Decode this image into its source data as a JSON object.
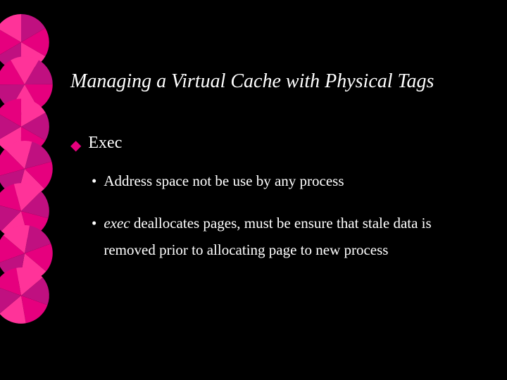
{
  "title": "Managing a Virtual Cache with Physical Tags",
  "bullet1": {
    "label": "Exec"
  },
  "sub1": {
    "text": "Address space not be use by any process"
  },
  "sub2": {
    "em": "exec",
    "rest": " deallocates pages, must be ensure that stale data is removed prior to allocating page to new process"
  }
}
